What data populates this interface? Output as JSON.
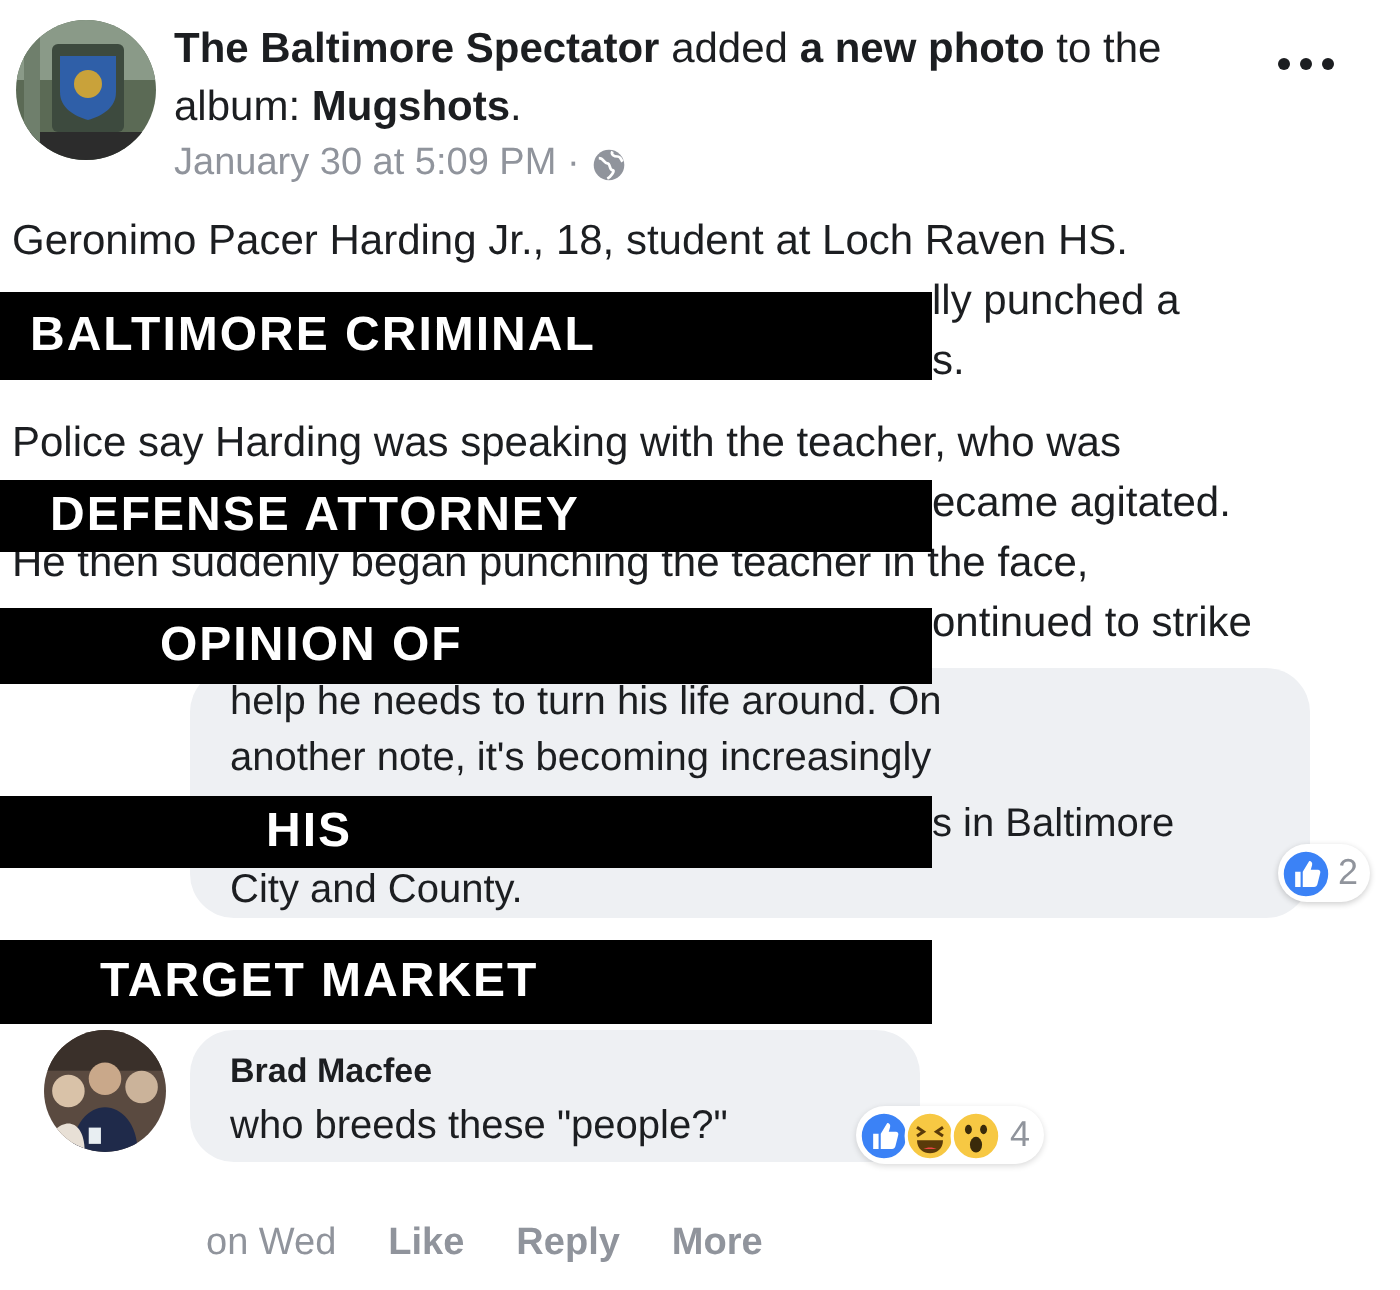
{
  "post": {
    "header": "**The Baltimore Spectator** added **a new photo** to the album: **Mugshots**.",
    "timestamp": "January 30 at 5:09 PM ·",
    "body_lines": [
      {
        "kind": "full",
        "text": "Geronimo Pacer Harding Jr., 18, student at Loch Raven HS."
      },
      {
        "kind": "fragment",
        "text": "lly punched a"
      },
      {
        "kind": "fragment",
        "text": "s."
      },
      {
        "kind": "gap"
      },
      {
        "kind": "full",
        "text": "Police say Harding was speaking with the teacher, who was"
      },
      {
        "kind": "fragment",
        "text": "ecame agitated."
      },
      {
        "kind": "full",
        "text": "He then suddenly began punching the teacher in the face,"
      },
      {
        "kind": "fragment",
        "text": "ontinued to strike"
      }
    ]
  },
  "comment": {
    "lines": [
      {
        "kind": "full",
        "text": "help he needs to turn his life around. On"
      },
      {
        "kind": "full",
        "text": "another note, it's becoming increasingly"
      },
      {
        "kind": "fragment",
        "text": "s in Baltimore"
      },
      {
        "kind": "full",
        "text": "City and County."
      }
    ],
    "reaction_count": "2"
  },
  "reply": {
    "name": "Brad Macfee",
    "text": "who breeds these \"people?\"",
    "reaction_count": "4",
    "time": "on Wed",
    "actions": [
      "Like",
      "Reply",
      "More"
    ]
  },
  "captions": [
    "BALTIMORE CRIMINAL",
    "DEFENSE ATTORNEY",
    "OPINION OF",
    "HIS",
    "TARGET MARKET"
  ]
}
